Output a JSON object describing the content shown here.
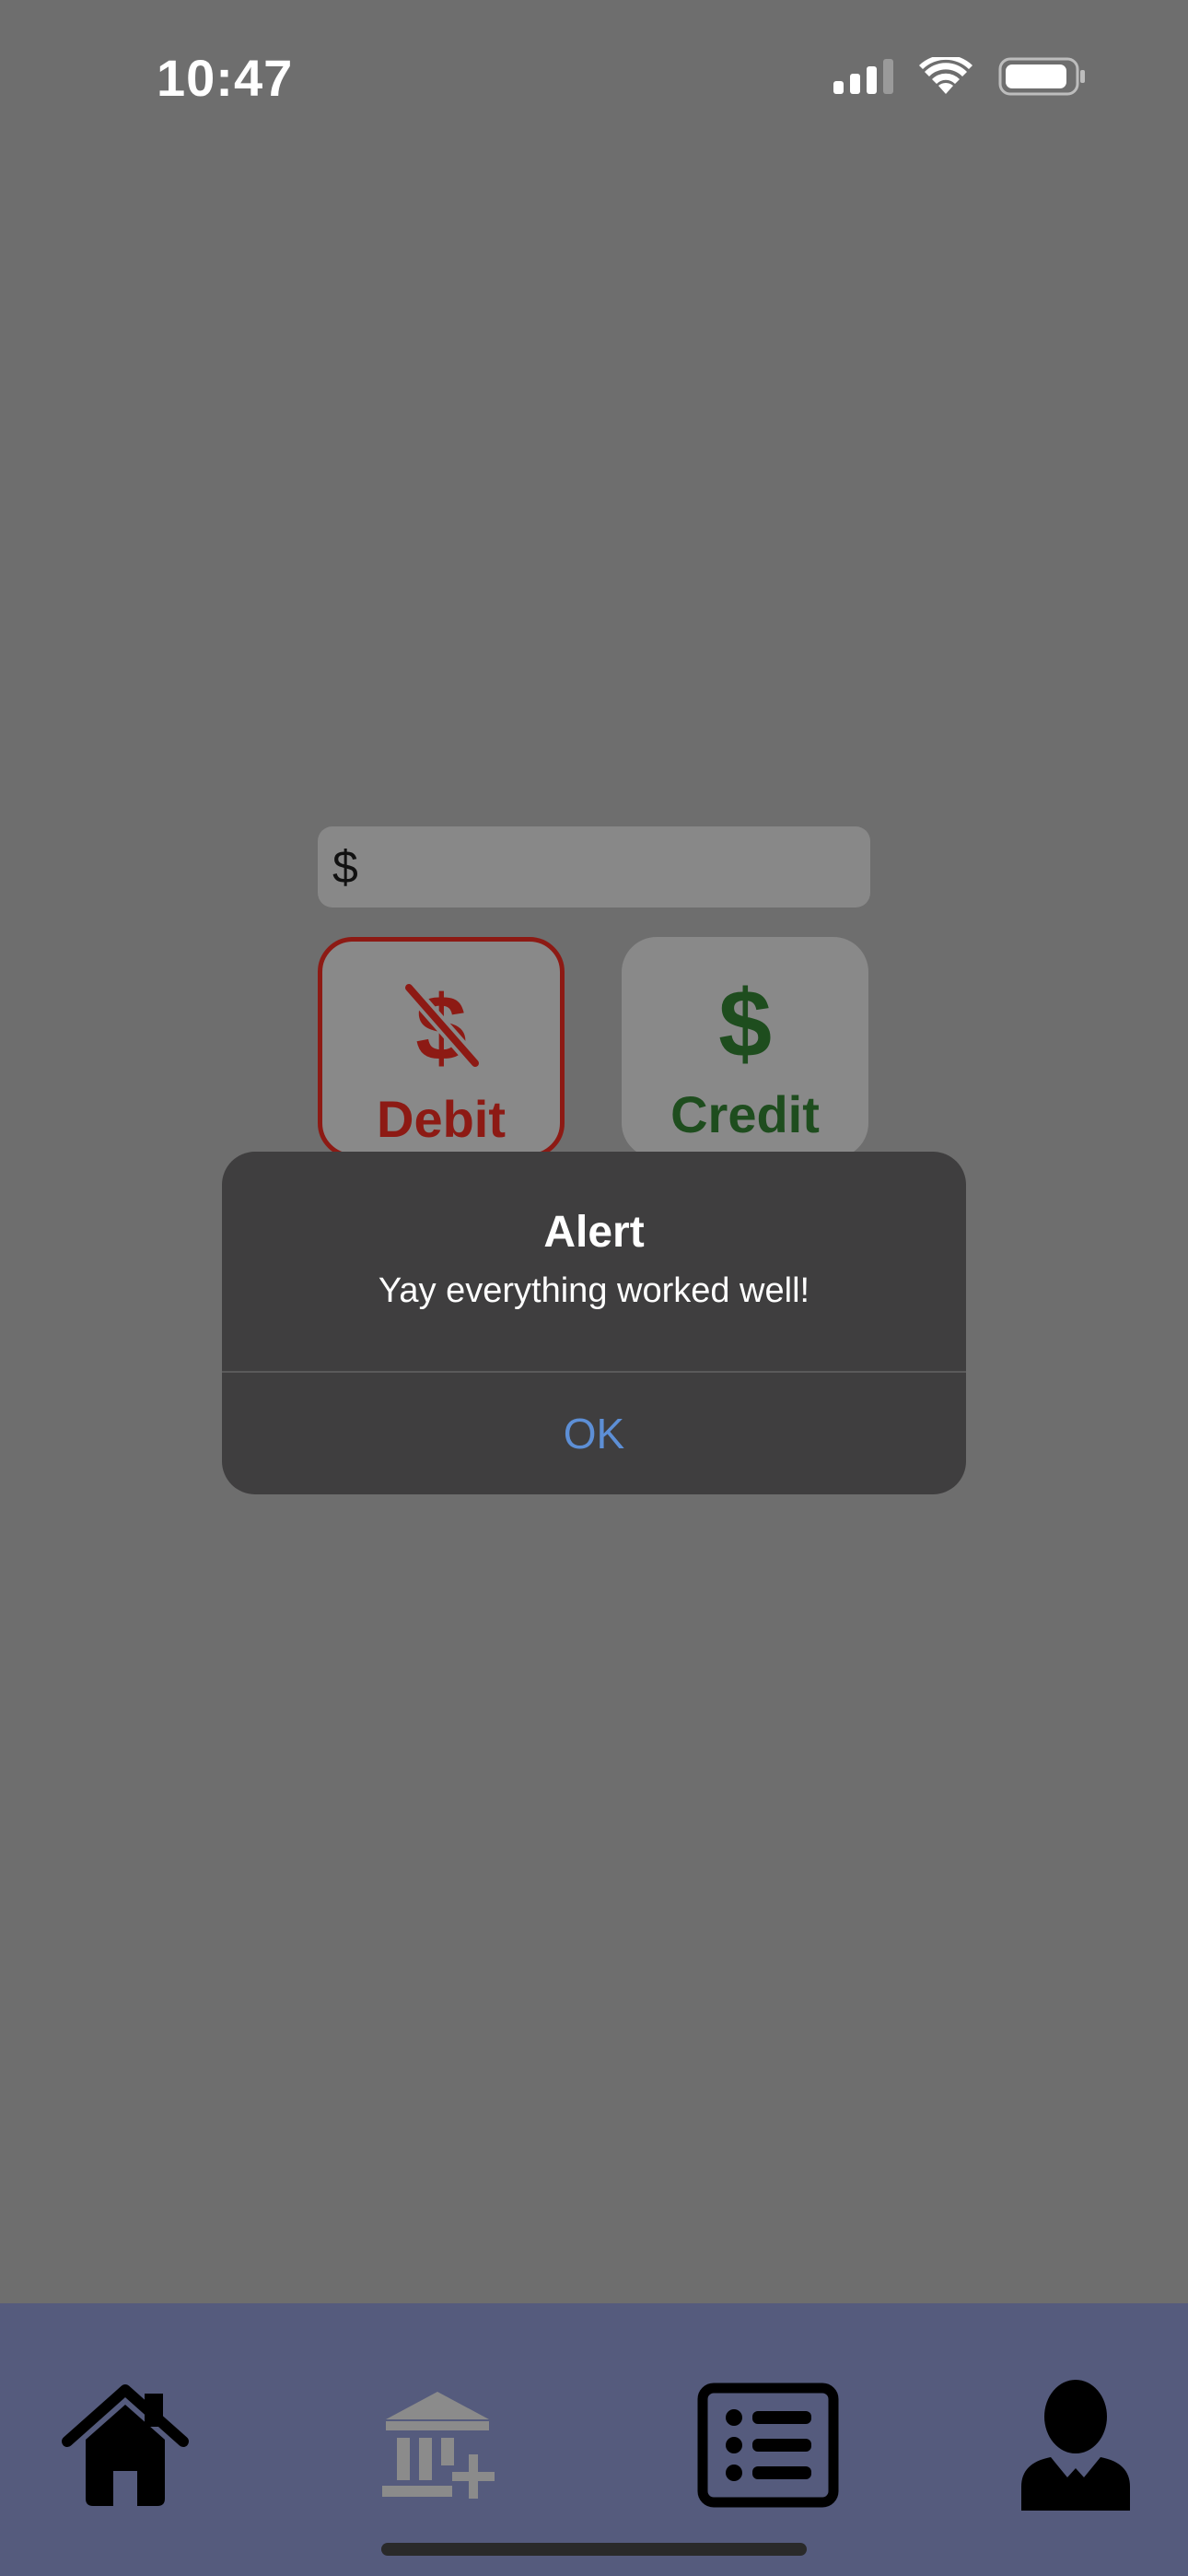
{
  "status_bar": {
    "time": "10:47",
    "icons": [
      "cellular-signal-icon",
      "wifi-icon",
      "battery-icon"
    ]
  },
  "form": {
    "amount": {
      "currency_symbol": "$",
      "value": "",
      "placeholder": ""
    },
    "transaction_types": [
      {
        "label": "Debit",
        "icon": "dollar-slash-icon",
        "selected": true,
        "color": "#8d1a14"
      },
      {
        "label": "Credit",
        "icon": "dollar-icon",
        "selected": false,
        "color": "#1e4d1e"
      }
    ]
  },
  "alert": {
    "title": "Alert",
    "message": "Yay everything worked well!",
    "ok_label": "OK",
    "ok_color": "#5d8fd6"
  },
  "tab_bar": {
    "background": "#555b7d",
    "items": [
      {
        "icon": "home-icon",
        "active": true
      },
      {
        "icon": "add-bank-icon",
        "active": false
      },
      {
        "icon": "list-icon",
        "active": true
      },
      {
        "icon": "profile-icon",
        "active": true
      }
    ]
  }
}
